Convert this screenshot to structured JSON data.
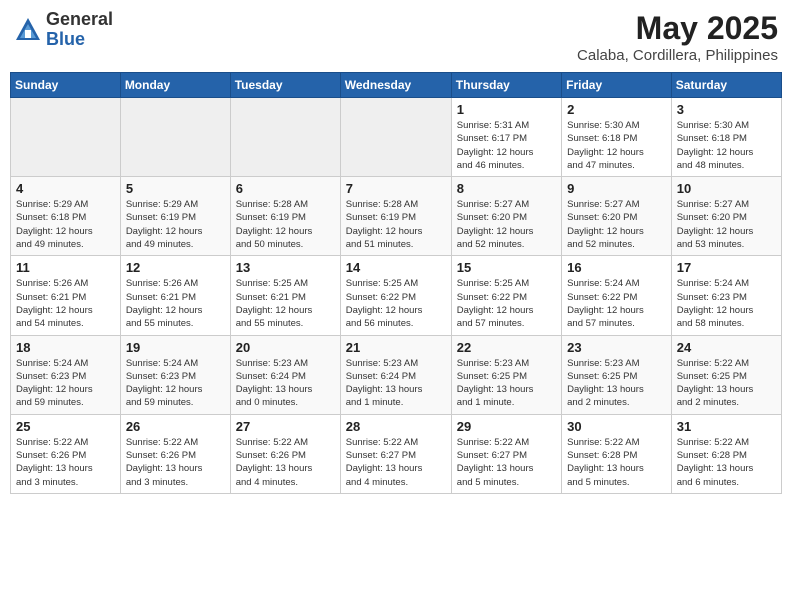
{
  "header": {
    "logo_general": "General",
    "logo_blue": "Blue",
    "month": "May 2025",
    "location": "Calaba, Cordillera, Philippines"
  },
  "weekdays": [
    "Sunday",
    "Monday",
    "Tuesday",
    "Wednesday",
    "Thursday",
    "Friday",
    "Saturday"
  ],
  "weeks": [
    [
      {
        "day": "",
        "info": ""
      },
      {
        "day": "",
        "info": ""
      },
      {
        "day": "",
        "info": ""
      },
      {
        "day": "",
        "info": ""
      },
      {
        "day": "1",
        "info": "Sunrise: 5:31 AM\nSunset: 6:17 PM\nDaylight: 12 hours\nand 46 minutes."
      },
      {
        "day": "2",
        "info": "Sunrise: 5:30 AM\nSunset: 6:18 PM\nDaylight: 12 hours\nand 47 minutes."
      },
      {
        "day": "3",
        "info": "Sunrise: 5:30 AM\nSunset: 6:18 PM\nDaylight: 12 hours\nand 48 minutes."
      }
    ],
    [
      {
        "day": "4",
        "info": "Sunrise: 5:29 AM\nSunset: 6:18 PM\nDaylight: 12 hours\nand 49 minutes."
      },
      {
        "day": "5",
        "info": "Sunrise: 5:29 AM\nSunset: 6:19 PM\nDaylight: 12 hours\nand 49 minutes."
      },
      {
        "day": "6",
        "info": "Sunrise: 5:28 AM\nSunset: 6:19 PM\nDaylight: 12 hours\nand 50 minutes."
      },
      {
        "day": "7",
        "info": "Sunrise: 5:28 AM\nSunset: 6:19 PM\nDaylight: 12 hours\nand 51 minutes."
      },
      {
        "day": "8",
        "info": "Sunrise: 5:27 AM\nSunset: 6:20 PM\nDaylight: 12 hours\nand 52 minutes."
      },
      {
        "day": "9",
        "info": "Sunrise: 5:27 AM\nSunset: 6:20 PM\nDaylight: 12 hours\nand 52 minutes."
      },
      {
        "day": "10",
        "info": "Sunrise: 5:27 AM\nSunset: 6:20 PM\nDaylight: 12 hours\nand 53 minutes."
      }
    ],
    [
      {
        "day": "11",
        "info": "Sunrise: 5:26 AM\nSunset: 6:21 PM\nDaylight: 12 hours\nand 54 minutes."
      },
      {
        "day": "12",
        "info": "Sunrise: 5:26 AM\nSunset: 6:21 PM\nDaylight: 12 hours\nand 55 minutes."
      },
      {
        "day": "13",
        "info": "Sunrise: 5:25 AM\nSunset: 6:21 PM\nDaylight: 12 hours\nand 55 minutes."
      },
      {
        "day": "14",
        "info": "Sunrise: 5:25 AM\nSunset: 6:22 PM\nDaylight: 12 hours\nand 56 minutes."
      },
      {
        "day": "15",
        "info": "Sunrise: 5:25 AM\nSunset: 6:22 PM\nDaylight: 12 hours\nand 57 minutes."
      },
      {
        "day": "16",
        "info": "Sunrise: 5:24 AM\nSunset: 6:22 PM\nDaylight: 12 hours\nand 57 minutes."
      },
      {
        "day": "17",
        "info": "Sunrise: 5:24 AM\nSunset: 6:23 PM\nDaylight: 12 hours\nand 58 minutes."
      }
    ],
    [
      {
        "day": "18",
        "info": "Sunrise: 5:24 AM\nSunset: 6:23 PM\nDaylight: 12 hours\nand 59 minutes."
      },
      {
        "day": "19",
        "info": "Sunrise: 5:24 AM\nSunset: 6:23 PM\nDaylight: 12 hours\nand 59 minutes."
      },
      {
        "day": "20",
        "info": "Sunrise: 5:23 AM\nSunset: 6:24 PM\nDaylight: 13 hours\nand 0 minutes."
      },
      {
        "day": "21",
        "info": "Sunrise: 5:23 AM\nSunset: 6:24 PM\nDaylight: 13 hours\nand 1 minute."
      },
      {
        "day": "22",
        "info": "Sunrise: 5:23 AM\nSunset: 6:25 PM\nDaylight: 13 hours\nand 1 minute."
      },
      {
        "day": "23",
        "info": "Sunrise: 5:23 AM\nSunset: 6:25 PM\nDaylight: 13 hours\nand 2 minutes."
      },
      {
        "day": "24",
        "info": "Sunrise: 5:22 AM\nSunset: 6:25 PM\nDaylight: 13 hours\nand 2 minutes."
      }
    ],
    [
      {
        "day": "25",
        "info": "Sunrise: 5:22 AM\nSunset: 6:26 PM\nDaylight: 13 hours\nand 3 minutes."
      },
      {
        "day": "26",
        "info": "Sunrise: 5:22 AM\nSunset: 6:26 PM\nDaylight: 13 hours\nand 3 minutes."
      },
      {
        "day": "27",
        "info": "Sunrise: 5:22 AM\nSunset: 6:26 PM\nDaylight: 13 hours\nand 4 minutes."
      },
      {
        "day": "28",
        "info": "Sunrise: 5:22 AM\nSunset: 6:27 PM\nDaylight: 13 hours\nand 4 minutes."
      },
      {
        "day": "29",
        "info": "Sunrise: 5:22 AM\nSunset: 6:27 PM\nDaylight: 13 hours\nand 5 minutes."
      },
      {
        "day": "30",
        "info": "Sunrise: 5:22 AM\nSunset: 6:28 PM\nDaylight: 13 hours\nand 5 minutes."
      },
      {
        "day": "31",
        "info": "Sunrise: 5:22 AM\nSunset: 6:28 PM\nDaylight: 13 hours\nand 6 minutes."
      }
    ]
  ]
}
